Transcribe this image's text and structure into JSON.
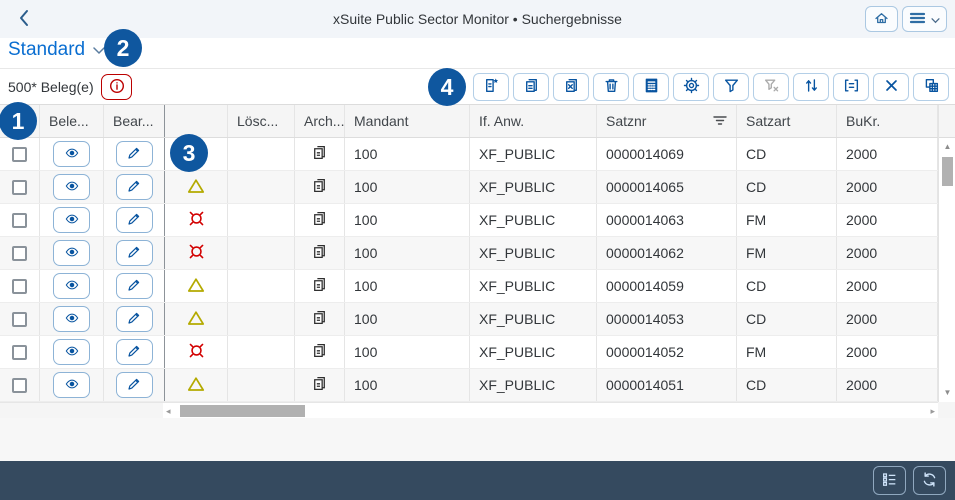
{
  "header": {
    "title": "xSuite Public Sector Monitor • Suchergebnisse"
  },
  "variant": {
    "name": "Standard"
  },
  "toolbar": {
    "count": "500* Beleg(e)",
    "buttons": [
      {
        "name": "add-document",
        "enabled": true
      },
      {
        "name": "copy-documents",
        "enabled": true
      },
      {
        "name": "remove-document",
        "enabled": true
      },
      {
        "name": "delete-trash",
        "enabled": true
      },
      {
        "name": "calculator",
        "enabled": true
      },
      {
        "name": "settings-gear",
        "enabled": true
      },
      {
        "name": "filter",
        "enabled": true
      },
      {
        "name": "clear-filter",
        "enabled": false
      },
      {
        "name": "sort",
        "enabled": true
      },
      {
        "name": "legend",
        "enabled": true
      },
      {
        "name": "close",
        "enabled": true
      },
      {
        "name": "export-table",
        "enabled": true
      }
    ]
  },
  "table": {
    "columns": [
      {
        "key": "select",
        "label": ""
      },
      {
        "key": "bele",
        "label": "Bele..."
      },
      {
        "key": "bear",
        "label": "Bear..."
      },
      {
        "key": "status",
        "label": ""
      },
      {
        "key": "loesc",
        "label": "Lösc..."
      },
      {
        "key": "arch",
        "label": "Arch..."
      },
      {
        "key": "mandant",
        "label": "Mandant"
      },
      {
        "key": "anw",
        "label": "If. Anw."
      },
      {
        "key": "satznr",
        "label": "Satznr"
      },
      {
        "key": "satzart",
        "label": "Satzart"
      },
      {
        "key": "bukr",
        "label": "BuKr."
      }
    ],
    "rows": [
      {
        "status": "none",
        "archived": true,
        "mandant": "100",
        "anw": "XF_PUBLIC",
        "satznr": "0000014069",
        "satzart": "CD",
        "bukr": "2000"
      },
      {
        "status": "warning",
        "archived": true,
        "mandant": "100",
        "anw": "XF_PUBLIC",
        "satznr": "0000014065",
        "satzart": "CD",
        "bukr": "2000"
      },
      {
        "status": "error",
        "archived": true,
        "mandant": "100",
        "anw": "XF_PUBLIC",
        "satznr": "0000014063",
        "satzart": "FM",
        "bukr": "2000"
      },
      {
        "status": "error",
        "archived": true,
        "mandant": "100",
        "anw": "XF_PUBLIC",
        "satznr": "0000014062",
        "satzart": "FM",
        "bukr": "2000"
      },
      {
        "status": "warning",
        "archived": true,
        "mandant": "100",
        "anw": "XF_PUBLIC",
        "satznr": "0000014059",
        "satzart": "CD",
        "bukr": "2000"
      },
      {
        "status": "warning",
        "archived": true,
        "mandant": "100",
        "anw": "XF_PUBLIC",
        "satznr": "0000014053",
        "satzart": "CD",
        "bukr": "2000"
      },
      {
        "status": "error",
        "archived": true,
        "mandant": "100",
        "anw": "XF_PUBLIC",
        "satznr": "0000014052",
        "satzart": "FM",
        "bukr": "2000"
      },
      {
        "status": "warning",
        "archived": true,
        "mandant": "100",
        "anw": "XF_PUBLIC",
        "satznr": "0000014051",
        "satzart": "CD",
        "bukr": "2000"
      }
    ]
  },
  "annotations": [
    {
      "label": "1"
    },
    {
      "label": "2"
    },
    {
      "label": "3"
    },
    {
      "label": "4"
    }
  ],
  "colors": {
    "accent_blue": "#0a6ed1",
    "icon_blue": "#0854a0",
    "badge_blue": "#0f579f",
    "error_red": "#d20000",
    "warning_olive": "#b4aa00",
    "info_red": "#bb0000",
    "footer_dark": "#354a5f"
  }
}
